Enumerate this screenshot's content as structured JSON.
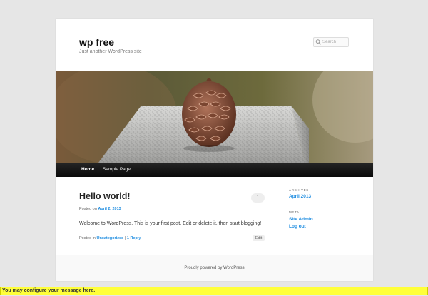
{
  "header": {
    "site_title": "wp free",
    "tagline": "Just another WordPress site",
    "search_placeholder": "Search"
  },
  "nav": {
    "items": [
      {
        "label": "Home",
        "current": true
      },
      {
        "label": "Sample Page",
        "current": false
      }
    ]
  },
  "post": {
    "title": "Hello world!",
    "comment_count": "1",
    "posted_on_prefix": "Posted on",
    "date": "April 2, 2013",
    "body": "Welcome to WordPress. This is your first post. Edit or delete it, then start blogging!",
    "posted_in_prefix": "Posted in",
    "category": "Uncategorized",
    "separator": "|",
    "reply_link": "1 Reply",
    "edit_label": "Edit"
  },
  "sidebar": {
    "archives_title": "Archives",
    "archives": [
      "April 2013"
    ],
    "meta_title": "Meta",
    "meta_links": [
      "Site Admin",
      "Log out"
    ]
  },
  "footer": {
    "credit": "Proudly powered by WordPress"
  },
  "notice": {
    "text": "You may configure your message here."
  },
  "colors": {
    "link": "#1b8be0",
    "notice_bg": "#ffff39",
    "nav_bg": "#111111"
  }
}
